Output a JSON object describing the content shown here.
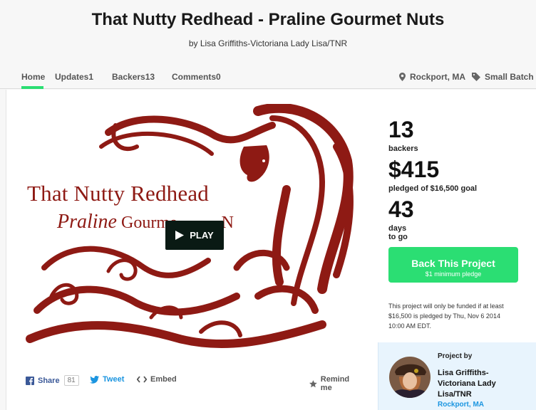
{
  "project": {
    "title": "That Nutty Redhead - Praline Gourmet Nuts",
    "byline": "by Lisa Griffiths-Victoriana Lady Lisa/TNR"
  },
  "nav": {
    "tabs": [
      {
        "label": "Home",
        "count": null,
        "active": true
      },
      {
        "label": "Updates",
        "count": "1"
      },
      {
        "label": "Backers",
        "count": "13"
      },
      {
        "label": "Comments",
        "count": "0"
      }
    ],
    "location": "Rockport, MA",
    "category": "Small Batch"
  },
  "video": {
    "title_line": "That Nutty Redhead",
    "sub_italic": "Praline",
    "sub_rest": " Gourme",
    "sub_tail": "N",
    "play_label": "PLAY"
  },
  "share": {
    "facebook_label": "Share",
    "facebook_count": "81",
    "tweet_label": "Tweet",
    "embed_label": "Embed",
    "remind_label": "Remind me"
  },
  "stats": {
    "backers_value": "13",
    "backers_label": "backers",
    "pledged_value": "$415",
    "pledged_label": "pledged of $16,500 goal",
    "days_value": "43",
    "days_label": "days to go"
  },
  "cta": {
    "label": "Back This Project",
    "sub_label": "$1 minimum pledge"
  },
  "funding_note": "This project will only be funded if at least $16,500 is pledged by Thu, Nov 6 2014 10:00 AM EDT.",
  "creator": {
    "heading": "Project by",
    "name": "Lisa Griffiths-Victoriana Lady Lisa/TNR",
    "location": "Rockport, MA"
  },
  "colors": {
    "accent_green": "#2bde73",
    "art_red": "#8e1a14",
    "facebook_blue": "#3b5998",
    "twitter_blue": "#1b95e0",
    "creator_bg": "#e8f4fd"
  }
}
